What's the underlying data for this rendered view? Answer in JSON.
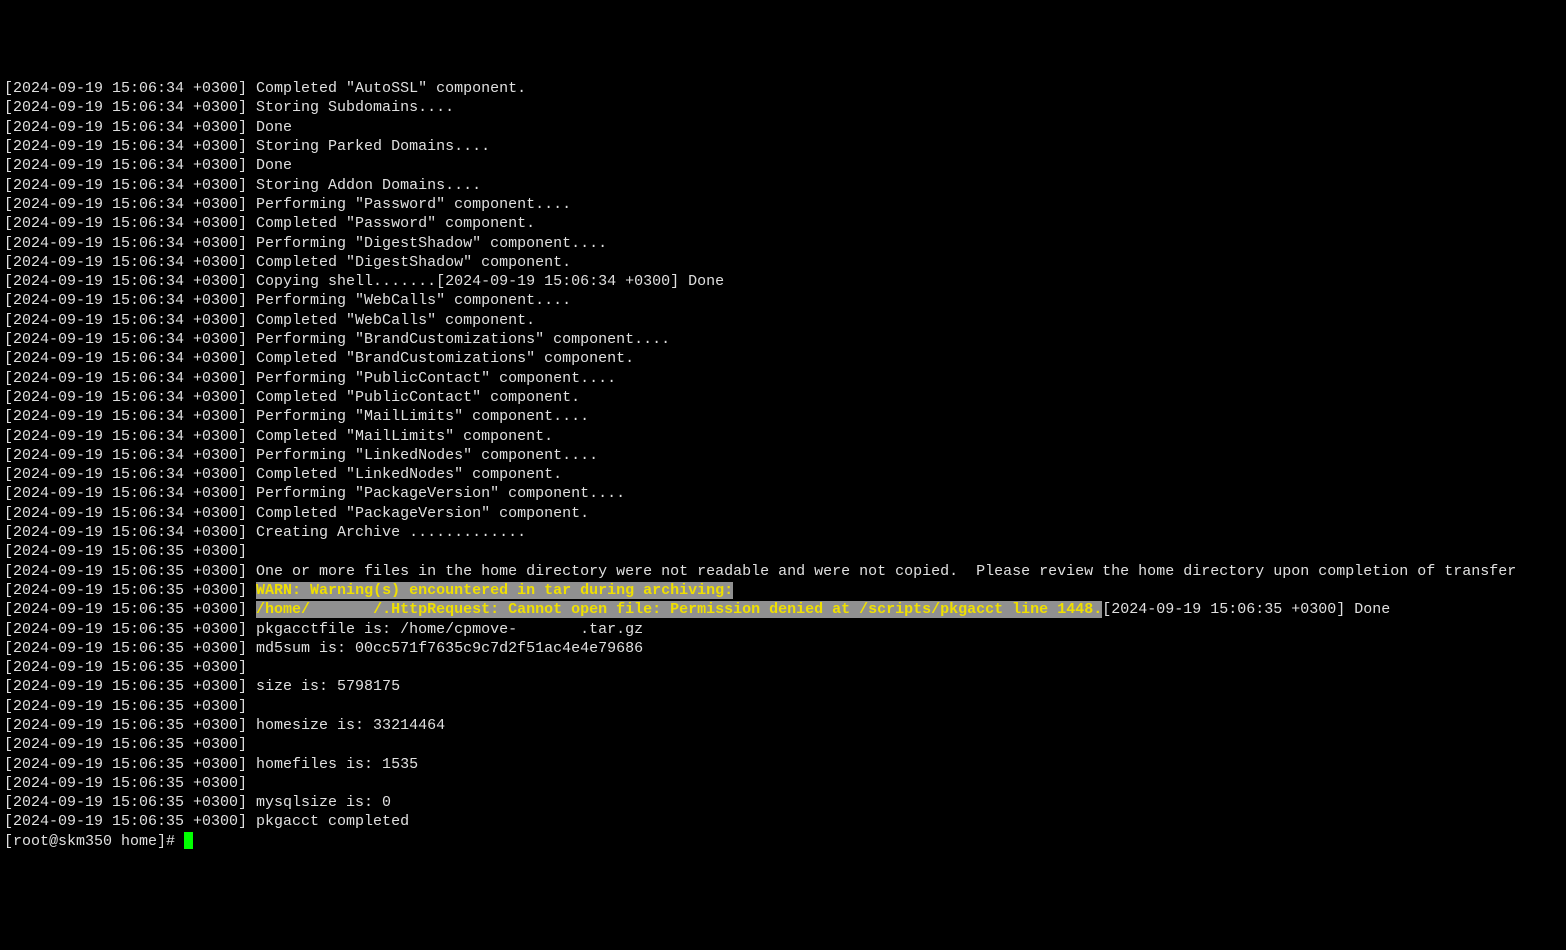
{
  "lines": [
    {
      "text": "[2024-09-19 15:06:34 +0300] Completed \"AutoSSL\" component."
    },
    {
      "text": "[2024-09-19 15:06:34 +0300] Storing Subdomains...."
    },
    {
      "text": "[2024-09-19 15:06:34 +0300] Done"
    },
    {
      "text": "[2024-09-19 15:06:34 +0300] Storing Parked Domains...."
    },
    {
      "text": "[2024-09-19 15:06:34 +0300] Done"
    },
    {
      "text": "[2024-09-19 15:06:34 +0300] Storing Addon Domains...."
    },
    {
      "text": "[2024-09-19 15:06:34 +0300] Performing \"Password\" component...."
    },
    {
      "text": "[2024-09-19 15:06:34 +0300] Completed \"Password\" component."
    },
    {
      "text": "[2024-09-19 15:06:34 +0300] Performing \"DigestShadow\" component...."
    },
    {
      "text": "[2024-09-19 15:06:34 +0300] Completed \"DigestShadow\" component."
    },
    {
      "text": "[2024-09-19 15:06:34 +0300] Copying shell.......[2024-09-19 15:06:34 +0300] Done"
    },
    {
      "text": "[2024-09-19 15:06:34 +0300] Performing \"WebCalls\" component...."
    },
    {
      "text": "[2024-09-19 15:06:34 +0300] Completed \"WebCalls\" component."
    },
    {
      "text": "[2024-09-19 15:06:34 +0300] Performing \"BrandCustomizations\" component...."
    },
    {
      "text": "[2024-09-19 15:06:34 +0300] Completed \"BrandCustomizations\" component."
    },
    {
      "text": "[2024-09-19 15:06:34 +0300] Performing \"PublicContact\" component...."
    },
    {
      "text": "[2024-09-19 15:06:34 +0300] Completed \"PublicContact\" component."
    },
    {
      "text": "[2024-09-19 15:06:34 +0300] Performing \"MailLimits\" component...."
    },
    {
      "text": "[2024-09-19 15:06:34 +0300] Completed \"MailLimits\" component."
    },
    {
      "text": "[2024-09-19 15:06:34 +0300] Performing \"LinkedNodes\" component...."
    },
    {
      "text": "[2024-09-19 15:06:34 +0300] Completed \"LinkedNodes\" component."
    },
    {
      "text": "[2024-09-19 15:06:34 +0300] Performing \"PackageVersion\" component...."
    },
    {
      "text": "[2024-09-19 15:06:34 +0300] Completed \"PackageVersion\" component."
    },
    {
      "text": "[2024-09-19 15:06:34 +0300] Creating Archive ............."
    },
    {
      "text": "[2024-09-19 15:06:35 +0300]"
    },
    {
      "text": "[2024-09-19 15:06:35 +0300] One or more files in the home directory were not readable and were not copied.  Please review the home directory upon completion of transfer"
    }
  ],
  "warn": {
    "ts1": "[2024-09-19 15:06:35 +0300] ",
    "hl1": "WARN: Warning(s) encountered in tar during archiving:",
    "ts2": "[2024-09-19 15:06:35 +0300] ",
    "hl2a": "/home/",
    "gap": "       ",
    "hl2b": "/.HttpRequest: Cannot open file: Permission denied at /scripts/pkgacct line 1448.",
    "after": "[2024-09-19 15:06:35 +0300] Done"
  },
  "lines2": [
    {
      "text": "[2024-09-19 15:06:35 +0300] pkgacctfile is: /home/cpmove-       .tar.gz"
    },
    {
      "text": "[2024-09-19 15:06:35 +0300] md5sum is: 00cc571f7635c9c7d2f51ac4e4e79686"
    },
    {
      "text": "[2024-09-19 15:06:35 +0300]"
    },
    {
      "text": "[2024-09-19 15:06:35 +0300] size is: 5798175"
    },
    {
      "text": "[2024-09-19 15:06:35 +0300]"
    },
    {
      "text": "[2024-09-19 15:06:35 +0300] homesize is: 33214464"
    },
    {
      "text": "[2024-09-19 15:06:35 +0300]"
    },
    {
      "text": "[2024-09-19 15:06:35 +0300] homefiles is: 1535"
    },
    {
      "text": "[2024-09-19 15:06:35 +0300]"
    },
    {
      "text": "[2024-09-19 15:06:35 +0300] mysqlsize is: 0"
    },
    {
      "text": "[2024-09-19 15:06:35 +0300] pkgacct completed"
    }
  ],
  "prompt": "[root@skm350 home]# "
}
